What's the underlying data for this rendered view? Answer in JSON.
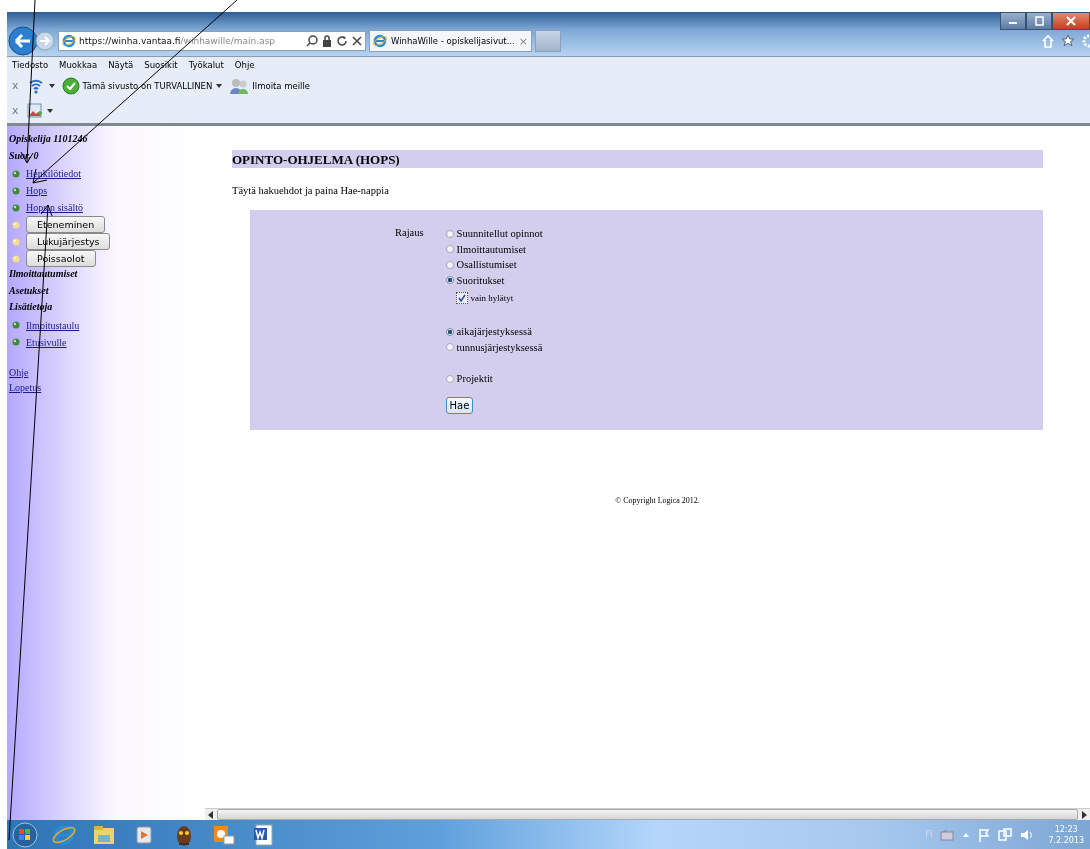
{
  "browser": {
    "url_host": "https://winha.vantaa.fi",
    "url_path": "/winhawille/main.asp",
    "tab_title": "WinhaWille - opiskelijasivut...",
    "tab_close": "×",
    "menu": [
      "Tiedosto",
      "Muokkaa",
      "Näytä",
      "Suosikit",
      "Työkalut",
      "Ohje"
    ],
    "toolbar_rows": [
      {
        "close": "x",
        "items": [
          {
            "kind": "wifi"
          },
          {
            "kind": "check",
            "text": "Tämä sivusto on TURVALLINEN"
          },
          {
            "kind": "people",
            "text": "Ilmoita meille"
          }
        ]
      },
      {
        "close": "x",
        "items": [
          {
            "kind": "image"
          }
        ]
      }
    ]
  },
  "sidebar": {
    "items": [
      {
        "kind": "heading",
        "text": "Opiskelija 1101246"
      },
      {
        "kind": "heading",
        "text": "Suor. 0"
      },
      {
        "kind": "link",
        "text": "Henkilötiedot"
      },
      {
        "kind": "link",
        "text": "Hops"
      },
      {
        "kind": "link",
        "text": "Hops:n sisältö"
      },
      {
        "kind": "button",
        "text": "Eteneminen"
      },
      {
        "kind": "button",
        "text": "Lukujärjestys"
      },
      {
        "kind": "button",
        "text": "Poissaolot"
      },
      {
        "kind": "heading",
        "text": "Ilmoittautumiset"
      },
      {
        "kind": "heading",
        "text": "Asetukset"
      },
      {
        "kind": "heading",
        "text": "Lisätietoja"
      },
      {
        "kind": "link",
        "text": "Ilmoitustaulu"
      },
      {
        "kind": "link",
        "text": "Etusivulle"
      },
      {
        "kind": "spacer"
      },
      {
        "kind": "plain_link",
        "text": "Ohje"
      },
      {
        "kind": "plain_link",
        "text": "Lopetus"
      }
    ]
  },
  "main": {
    "title": "OPINTO-OHJELMA (HOPS)",
    "instruction": "Täytä hakuehdot ja paina Hae-nappia",
    "form": {
      "label": "Rajaus",
      "option_groups": [
        [
          {
            "kind": "radio",
            "label": "Suunnitellut opinnot",
            "selected": false
          },
          {
            "kind": "radio",
            "label": "Ilmoittautumiset",
            "selected": false
          },
          {
            "kind": "radio",
            "label": "Osallistumiset",
            "selected": false
          },
          {
            "kind": "radio",
            "label": "Suoritukset",
            "selected": true
          },
          {
            "kind": "checkbox",
            "label": "vain hylätyt",
            "checked": true
          }
        ],
        [
          {
            "kind": "radio",
            "label": "aikajärjestyksessä",
            "selected": true
          },
          {
            "kind": "radio",
            "label": "tunnusjärjestyksessä",
            "selected": false
          }
        ],
        [
          {
            "kind": "radio",
            "label": "Projektit",
            "selected": false
          }
        ]
      ],
      "button": "Hae"
    },
    "footer": "© Copyright  Logica 2012."
  },
  "taskbar": {
    "language": "FI",
    "time": "12:23",
    "date": "7.2.2013"
  }
}
